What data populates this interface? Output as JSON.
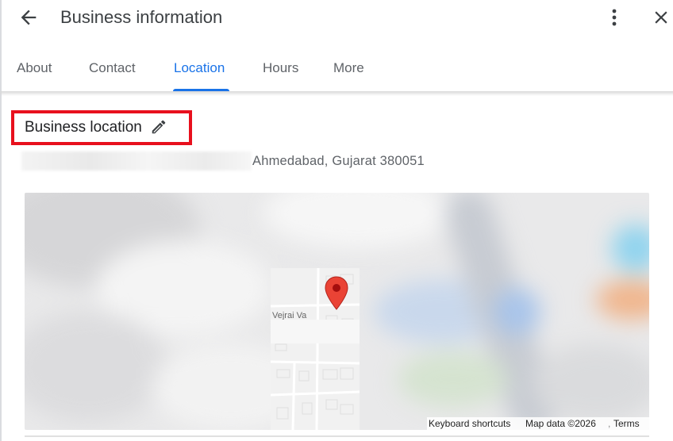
{
  "header": {
    "title": "Business information",
    "back_icon": "arrow-left-icon",
    "more_icon": "more-vertical-icon",
    "close_icon": "close-icon"
  },
  "tabs": [
    {
      "label": "About",
      "active": false
    },
    {
      "label": "Contact",
      "active": false
    },
    {
      "label": "Location",
      "active": true
    },
    {
      "label": "Hours",
      "active": false
    },
    {
      "label": "More",
      "active": false
    }
  ],
  "location": {
    "section_title": "Business location",
    "edit_icon": "pencil-icon",
    "address_visible": "Ahmedabad, Gujarat 380051"
  },
  "map": {
    "street_label": "Vejrai Va",
    "footer": {
      "keyboard_shortcuts": "Keyboard shortcuts",
      "map_data": "Map data ©2026",
      "terms": "Terms"
    }
  },
  "colors": {
    "accent": "#1a73e8",
    "highlight": "#e8101d",
    "pin": "#ea4335"
  }
}
